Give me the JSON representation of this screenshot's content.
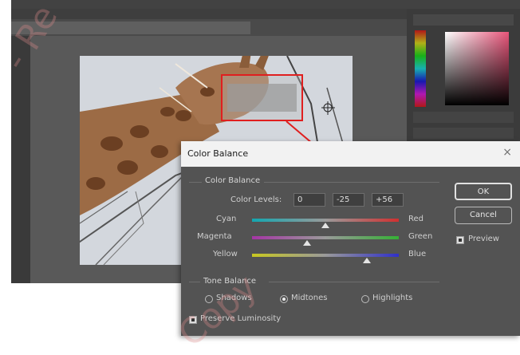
{
  "dialog": {
    "title": "Color Balance",
    "color_balance_group": "Color Balance",
    "color_levels_label": "Color Levels:",
    "levels": [
      "0",
      "-25",
      "+56"
    ],
    "sliders": [
      {
        "left": "Cyan",
        "right": "Red",
        "value": 0
      },
      {
        "left": "Magenta",
        "right": "Green",
        "value": -25
      },
      {
        "left": "Yellow",
        "right": "Blue",
        "value": 56
      }
    ],
    "tone_balance_group": "Tone Balance",
    "tones": [
      "Shadows",
      "Midtones",
      "Highlights"
    ],
    "selected_tone": "Midtones",
    "preserve_luminosity": "Preserve Luminosity",
    "preserve_luminosity_checked": true,
    "ok_label": "OK",
    "cancel_label": "Cancel",
    "preview_label": "Preview",
    "preview_checked": true,
    "close_glyph": "×"
  },
  "watermarks": [
    "- Re",
    "Copy"
  ],
  "colors": {
    "highlight": "#e01f1f",
    "dialog_bg": "#535353",
    "workspace": "#535353"
  }
}
